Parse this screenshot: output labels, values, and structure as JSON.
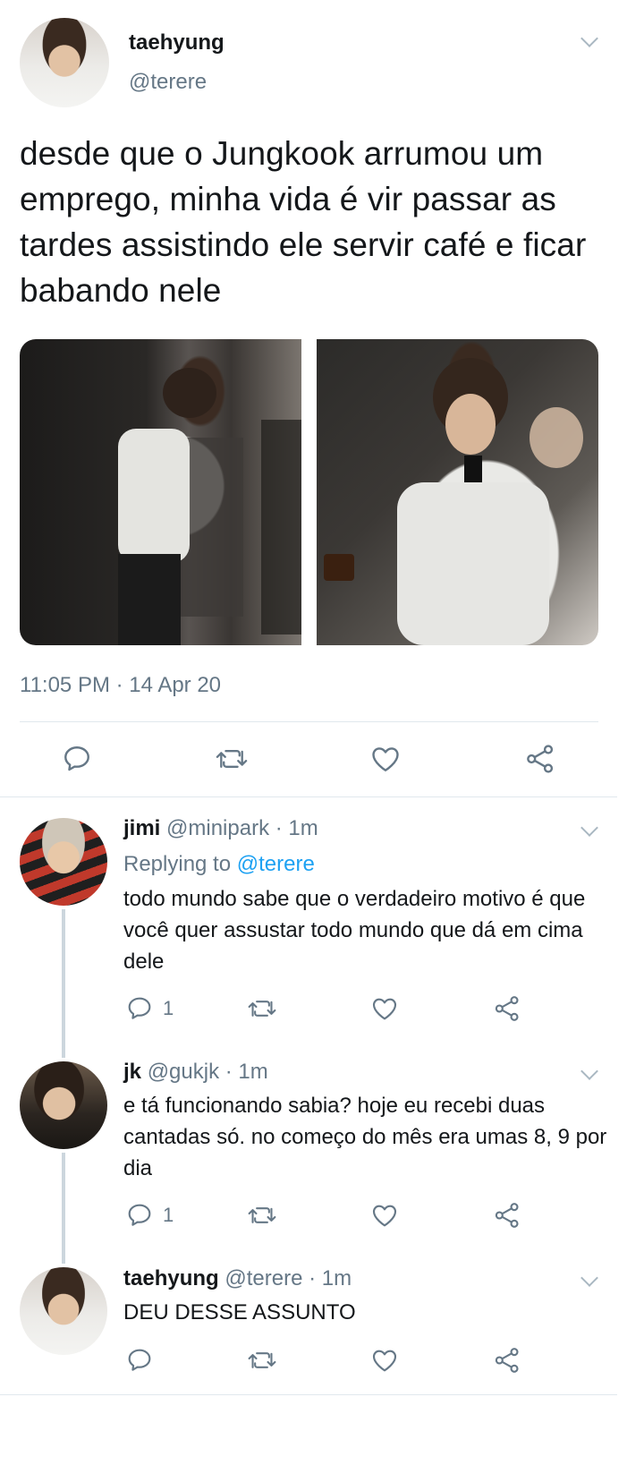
{
  "tweet": {
    "display_name": "taehyung",
    "handle": "@terere",
    "text": "desde que o Jungkook arrumou um emprego, minha vida é vir passar as tardes assistindo ele servir café e ficar babando nele",
    "timestamp": "11:05 PM · 14 Apr 20",
    "images": [
      {
        "icon": "photo-barista-making-coffee"
      },
      {
        "icon": "photo-barista-holding-espresso"
      }
    ]
  },
  "replies": [
    {
      "name": "jimi",
      "handle": "@minipark",
      "sep": " · ",
      "time": "1m",
      "replying_label": "Replying to ",
      "replying_to": "@terere",
      "text": "todo mundo sabe que o verdadeiro motivo é que você quer assustar todo mundo que dá em cima dele",
      "reply_count": "1"
    },
    {
      "name": "jk",
      "handle": "@gukjk",
      "sep": " · ",
      "time": "1m",
      "text": "e tá funcionando sabia? hoje eu recebi duas cantadas só. no começo do mês era umas 8, 9 por dia",
      "reply_count": "1"
    },
    {
      "name": "taehyung",
      "handle": "@terere",
      "sep": " · ",
      "time": "1m",
      "text": "DEU DESSE ASSUNTO"
    }
  ],
  "colors": {
    "text": "#14171a",
    "secondary": "#657786",
    "link": "#1da1f2",
    "divider": "#e1e8ed",
    "icon": "#657786"
  }
}
